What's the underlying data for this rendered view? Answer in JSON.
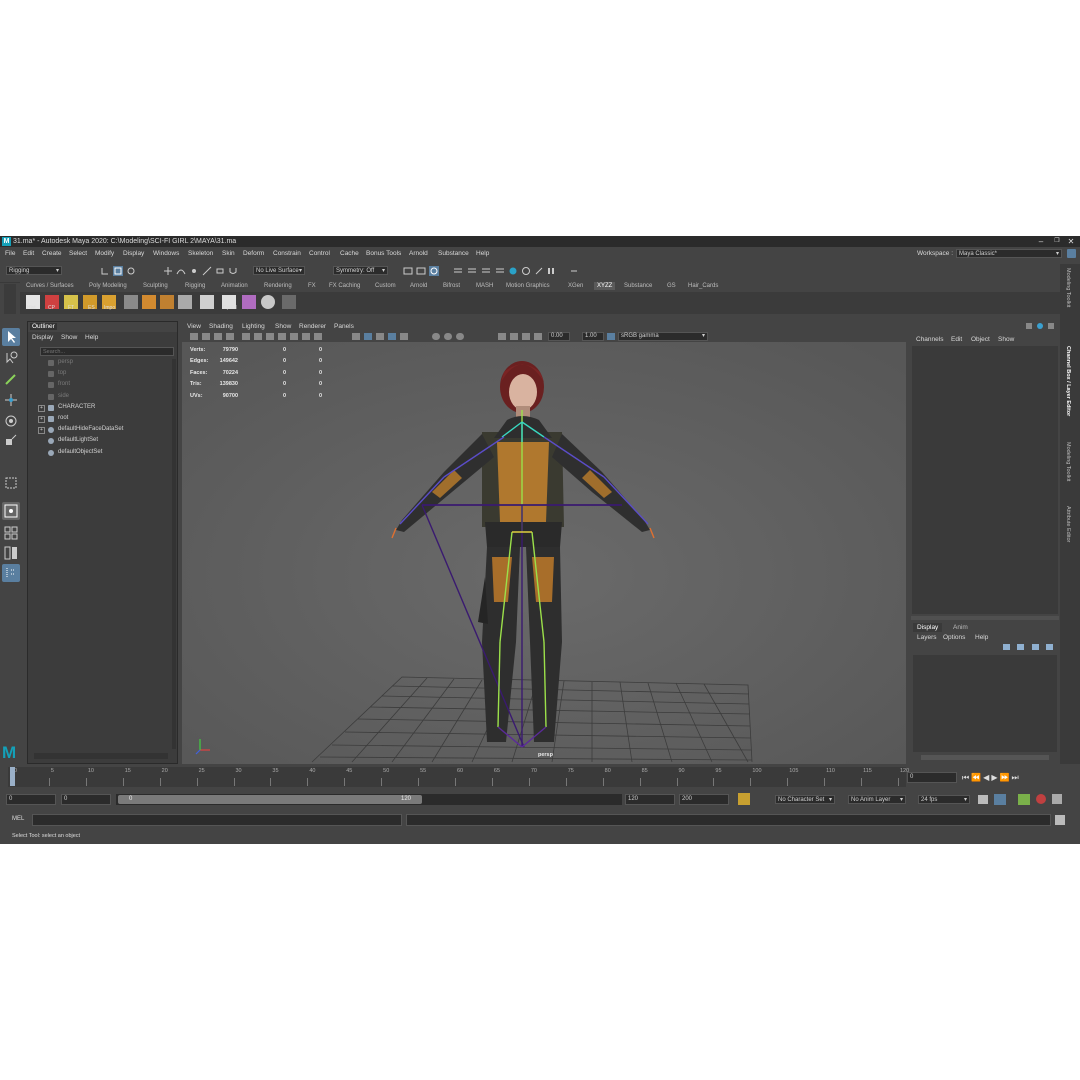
{
  "window": {
    "title": "31.ma* - Autodesk Maya 2020: C:\\Modeling\\SCI-FI GIRL 2\\MAYA\\31.ma",
    "logo_letter": "M",
    "minimize": "–",
    "maximize": "❐",
    "close": "✕"
  },
  "menubar": {
    "items": [
      "File",
      "Edit",
      "Create",
      "Select",
      "Modify",
      "Display",
      "Windows",
      "Skeleton",
      "Skin",
      "Deform",
      "Constrain",
      "Control",
      "Cache",
      "Bonus Tools",
      "Arnold",
      "Substance",
      "Help"
    ],
    "workspace_label": "Workspace :",
    "workspace_value": "Maya Classic*"
  },
  "toolbar": {
    "menuset": "Rigging",
    "live_surface": "No Live Surface",
    "symmetry": "Symmetry: Off"
  },
  "shelf": {
    "tabs": [
      "Curves / Surfaces",
      "Poly Modeling",
      "Sculpting",
      "Rigging",
      "Animation",
      "Rendering",
      "FX",
      "FX Caching",
      "Custom",
      "Arnold",
      "Bifrost",
      "MASH",
      "Motion Graphics",
      "XGen",
      "XYZZ",
      "Substance",
      "GS",
      "Hair_Cards"
    ],
    "active_tab": "XYZZ",
    "buttons": [
      "Hist",
      "CP",
      "FT",
      "ES",
      "Impo",
      "",
      "",
      "",
      "",
      "",
      "CplEd",
      "",
      ""
    ]
  },
  "outliner": {
    "title": "Outliner",
    "menu": [
      "Display",
      "Show",
      "Help"
    ],
    "search_placeholder": "Search...",
    "items": [
      {
        "label": "persp",
        "dim": true,
        "expand": false
      },
      {
        "label": "top",
        "dim": true,
        "expand": false
      },
      {
        "label": "front",
        "dim": true,
        "expand": false
      },
      {
        "label": "side",
        "dim": true,
        "expand": false
      },
      {
        "label": "CHARACTER",
        "dim": false,
        "expand": true
      },
      {
        "label": "root",
        "dim": false,
        "expand": true
      },
      {
        "label": "defaultHideFaceDataSet",
        "dim": false,
        "expand": true
      },
      {
        "label": "defaultLightSet",
        "dim": false,
        "expand": false
      },
      {
        "label": "defaultObjectSet",
        "dim": false,
        "expand": false
      }
    ]
  },
  "viewport": {
    "menu": [
      "View",
      "Shading",
      "Lighting",
      "Show",
      "Renderer",
      "Panels"
    ],
    "exposure": "0.00",
    "gamma": "1.00",
    "color_space": "sRGB gamma",
    "camera_label": "persp",
    "hud": [
      {
        "label": "Verts:",
        "v1": "79790",
        "v2": "0",
        "v3": "0"
      },
      {
        "label": "Edges:",
        "v1": "149642",
        "v2": "0",
        "v3": "0"
      },
      {
        "label": "Faces:",
        "v1": "70224",
        "v2": "0",
        "v3": "0"
      },
      {
        "label": "Tris:",
        "v1": "139830",
        "v2": "0",
        "v3": "0"
      },
      {
        "label": "UVs:",
        "v1": "90700",
        "v2": "0",
        "v3": "0"
      }
    ]
  },
  "channel_box": {
    "menu": [
      "Channels",
      "Edit",
      "Object",
      "Show"
    ]
  },
  "layer_editor": {
    "tabs": [
      "Display",
      "Anim"
    ],
    "menu": [
      "Layers",
      "Options",
      "Help"
    ]
  },
  "side_tabs": [
    "Modeling Toolkit",
    "Channel Box / Layer Editor",
    "Modeling Toolkit",
    "Attribute Editor"
  ],
  "timeline": {
    "ticks": [
      "0",
      "5",
      "10",
      "15",
      "20",
      "25",
      "30",
      "35",
      "40",
      "45",
      "50",
      "55",
      "60",
      "65",
      "70",
      "75",
      "80",
      "85",
      "90",
      "95",
      "100",
      "105",
      "110",
      "115",
      "120"
    ],
    "current_frame": "0"
  },
  "range": {
    "start": "0",
    "anim_start": "0",
    "slider_start": "0",
    "slider_end": "120",
    "anim_end": "120",
    "end": "200",
    "character_set": "No Character Set",
    "anim_layer": "No Anim Layer",
    "fps": "24 fps"
  },
  "command_line": {
    "label": "MEL"
  },
  "status_line": "Select Tool: select an object"
}
